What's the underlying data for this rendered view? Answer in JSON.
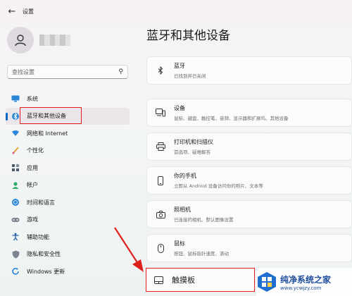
{
  "app": {
    "title": "设置"
  },
  "search": {
    "placeholder": "查找设置"
  },
  "nav": [
    {
      "label": "系统",
      "icon": "monitor-icon"
    },
    {
      "label": "蓝牙和其他设备",
      "icon": "bluetooth-icon",
      "active": true
    },
    {
      "label": "网络和 Internet",
      "icon": "wifi-icon"
    },
    {
      "label": "个性化",
      "icon": "brush-icon"
    },
    {
      "label": "应用",
      "icon": "apps-icon"
    },
    {
      "label": "帐户",
      "icon": "person-icon"
    },
    {
      "label": "时间和语言",
      "icon": "globe-clock-icon"
    },
    {
      "label": "游戏",
      "icon": "gamepad-icon"
    },
    {
      "label": "辅助功能",
      "icon": "accessibility-icon"
    },
    {
      "label": "隐私和安全性",
      "icon": "shield-icon"
    },
    {
      "label": "Windows 更新",
      "icon": "update-icon"
    }
  ],
  "main": {
    "title": "蓝牙和其他设备",
    "cards": [
      {
        "title": "蓝牙",
        "subtitle": "已找到并已关闭",
        "icon": "bluetooth-icon"
      },
      {
        "title": "设备",
        "subtitle": "鼠标、键盘、触控笔、音频、显示器和扩展坞、其他设备",
        "icon": "devices-icon"
      },
      {
        "title": "打印机和扫描仪",
        "subtitle": "首选项、疑难解答",
        "icon": "printer-icon"
      },
      {
        "title": "你的手机",
        "subtitle": "立即从 Android 设备访问你的照片、文本等",
        "icon": "phone-icon"
      },
      {
        "title": "照相机",
        "subtitle": "已连接的相机、默认图像设置",
        "icon": "camera-icon"
      },
      {
        "title": "鼠标",
        "subtitle": "按钮、鼠标指针速度、滚动",
        "icon": "mouse-icon"
      },
      {
        "title": "触摸板",
        "subtitle": "",
        "icon": "touchpad-icon"
      }
    ]
  },
  "watermark": {
    "title": "纯净系统之家",
    "url": "www.ycwjzy.com"
  },
  "colors": {
    "accent": "#0067c0",
    "highlight": "#e0201e"
  }
}
